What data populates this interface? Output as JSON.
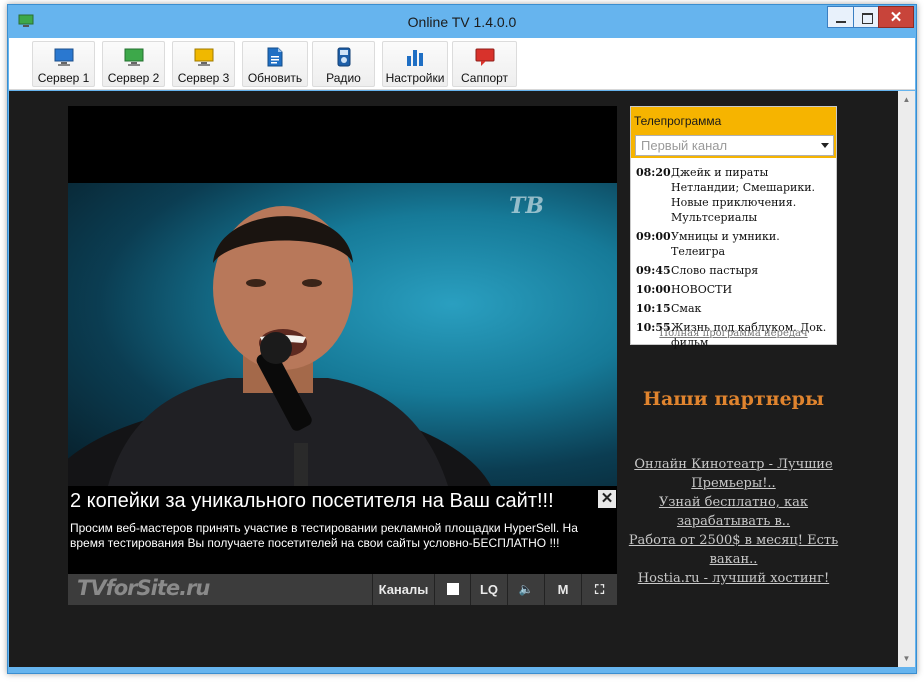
{
  "window": {
    "title": "Online TV 1.4.0.0",
    "close_glyph": "✕"
  },
  "toolbar": {
    "buttons": [
      {
        "label": "Сервер 1",
        "icon": "monitor-blue-icon"
      },
      {
        "label": "Сервер 2",
        "icon": "monitor-green-icon"
      },
      {
        "label": "Сервер 3",
        "icon": "monitor-yellow-icon"
      },
      {
        "label": "Обновить",
        "icon": "document-icon"
      },
      {
        "label": "Радио",
        "icon": "radio-icon"
      },
      {
        "label": "Настройки",
        "icon": "bar-chart-icon"
      },
      {
        "label": "Саппорт",
        "icon": "chat-bubble-icon"
      }
    ]
  },
  "player": {
    "channel_logo": "ТВ",
    "ad": {
      "title": "2 копейки за уникального посетителя на Ваш сайт!!!",
      "text": "Просим веб-мастеров принять участие в тестировании рекламной площадки HyperSell. На время тестирования Вы получаете посетителей на свои сайты условно-БЕСПЛАТНО !!!",
      "close_glyph": "✕"
    },
    "brand": "TVforSite.ru",
    "controls": {
      "channels": "Каналы",
      "quality": "LQ",
      "volume_glyph": "🔈",
      "mute": "M",
      "fullscreen_glyph": "⛶"
    }
  },
  "epg": {
    "title": "Телепрограмма",
    "channel_select": "Первый канал",
    "items": [
      {
        "time": "08:20",
        "show": "Джейк и пираты Нетландии; Смешарики. Новые приключения. Мультсериалы"
      },
      {
        "time": "09:00",
        "show": "Умницы и умники. Телеигра"
      },
      {
        "time": "09:45",
        "show": "Слово пастыря"
      },
      {
        "time": "10:00",
        "show": "НОВОСТИ"
      },
      {
        "time": "10:15",
        "show": "Смак"
      },
      {
        "time": "10:55",
        "show": "Жизнь под каблуком. Док. фильм"
      }
    ],
    "full_link": "Полная программа передач"
  },
  "partners": {
    "title": "Наши партнеры",
    "links": [
      "Онлайн Кинотеатр - Лучшие Премьеры!..",
      "Узнай бесплатно, как зарабатывать в..",
      "Работа от 2500$ в месяц! Есть вакан..",
      "Hostia.ru - лучший хостинг!"
    ]
  },
  "colors": {
    "titlebar": "#66b4ee",
    "content_bg": "#1c1c1c",
    "epg_header": "#f6b400",
    "partners_title": "#e0842e",
    "close_button": "#c8443a"
  }
}
